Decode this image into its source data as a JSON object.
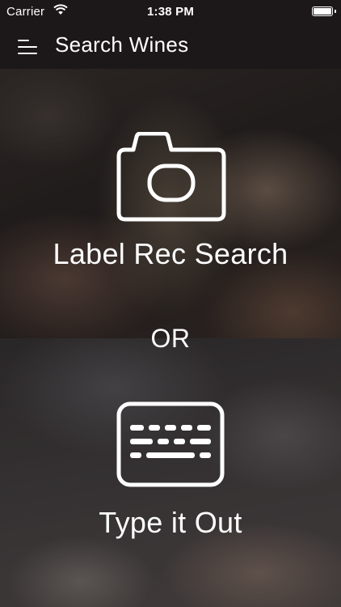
{
  "status_bar": {
    "carrier": "Carrier",
    "time": "1:38 PM",
    "wifi_icon": "wifi-icon",
    "battery_icon": "battery-icon"
  },
  "nav": {
    "menu_icon": "hamburger-menu-icon",
    "title": "Search Wines"
  },
  "options": {
    "label_rec": {
      "icon": "camera-icon",
      "label": "Label Rec Search"
    },
    "divider": "OR",
    "type_it": {
      "icon": "keyboard-icon",
      "label": "Type it Out"
    }
  },
  "colors": {
    "bar_background": "#1c1718",
    "text": "#ffffff"
  }
}
